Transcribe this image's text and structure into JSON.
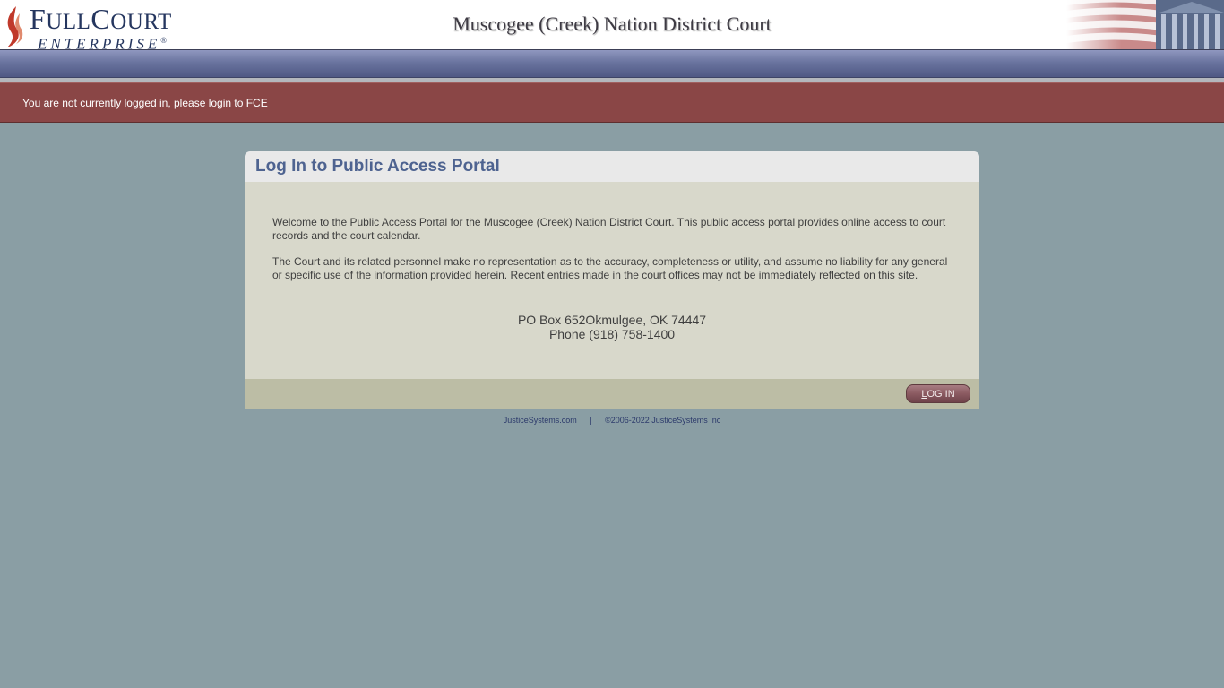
{
  "header": {
    "logo": {
      "word1": "F",
      "word1_small": "ULL",
      "word2": "C",
      "word2_small": "OURT",
      "sub": "ENTERPRISE",
      "reg": "®"
    },
    "court_title": "Muscogee (Creek) Nation District Court"
  },
  "alert": {
    "message": "You are not currently logged in, please login to FCE"
  },
  "panel": {
    "title": "Log In to Public Access Portal",
    "paragraphs": [
      "Welcome to the Public Access Portal for the Muscogee (Creek) Nation District Court. This public access portal provides online access to court records and the court calendar.",
      "The Court and its related personnel make no representation as to the accuracy, completeness or utility, and assume no liability for any general or specific use of the information provided herein. Recent entries made in the court offices may not be immediately reflected on this site."
    ],
    "address_line": "PO Box 652Okmulgee, OK 74447",
    "phone_line": "Phone (918) 758-1400",
    "login_button": {
      "accesskey_letter": "L",
      "rest": "OG IN"
    }
  },
  "footer": {
    "link": "JusticeSystems.com",
    "divider": "|",
    "copyright": "©2006-2022 JusticeSystems Inc"
  },
  "colors": {
    "background": "#8a9ea4",
    "alert": "#8a4646",
    "title": "#4e6390",
    "brand": "#25365f",
    "flame": "#c0392b"
  }
}
